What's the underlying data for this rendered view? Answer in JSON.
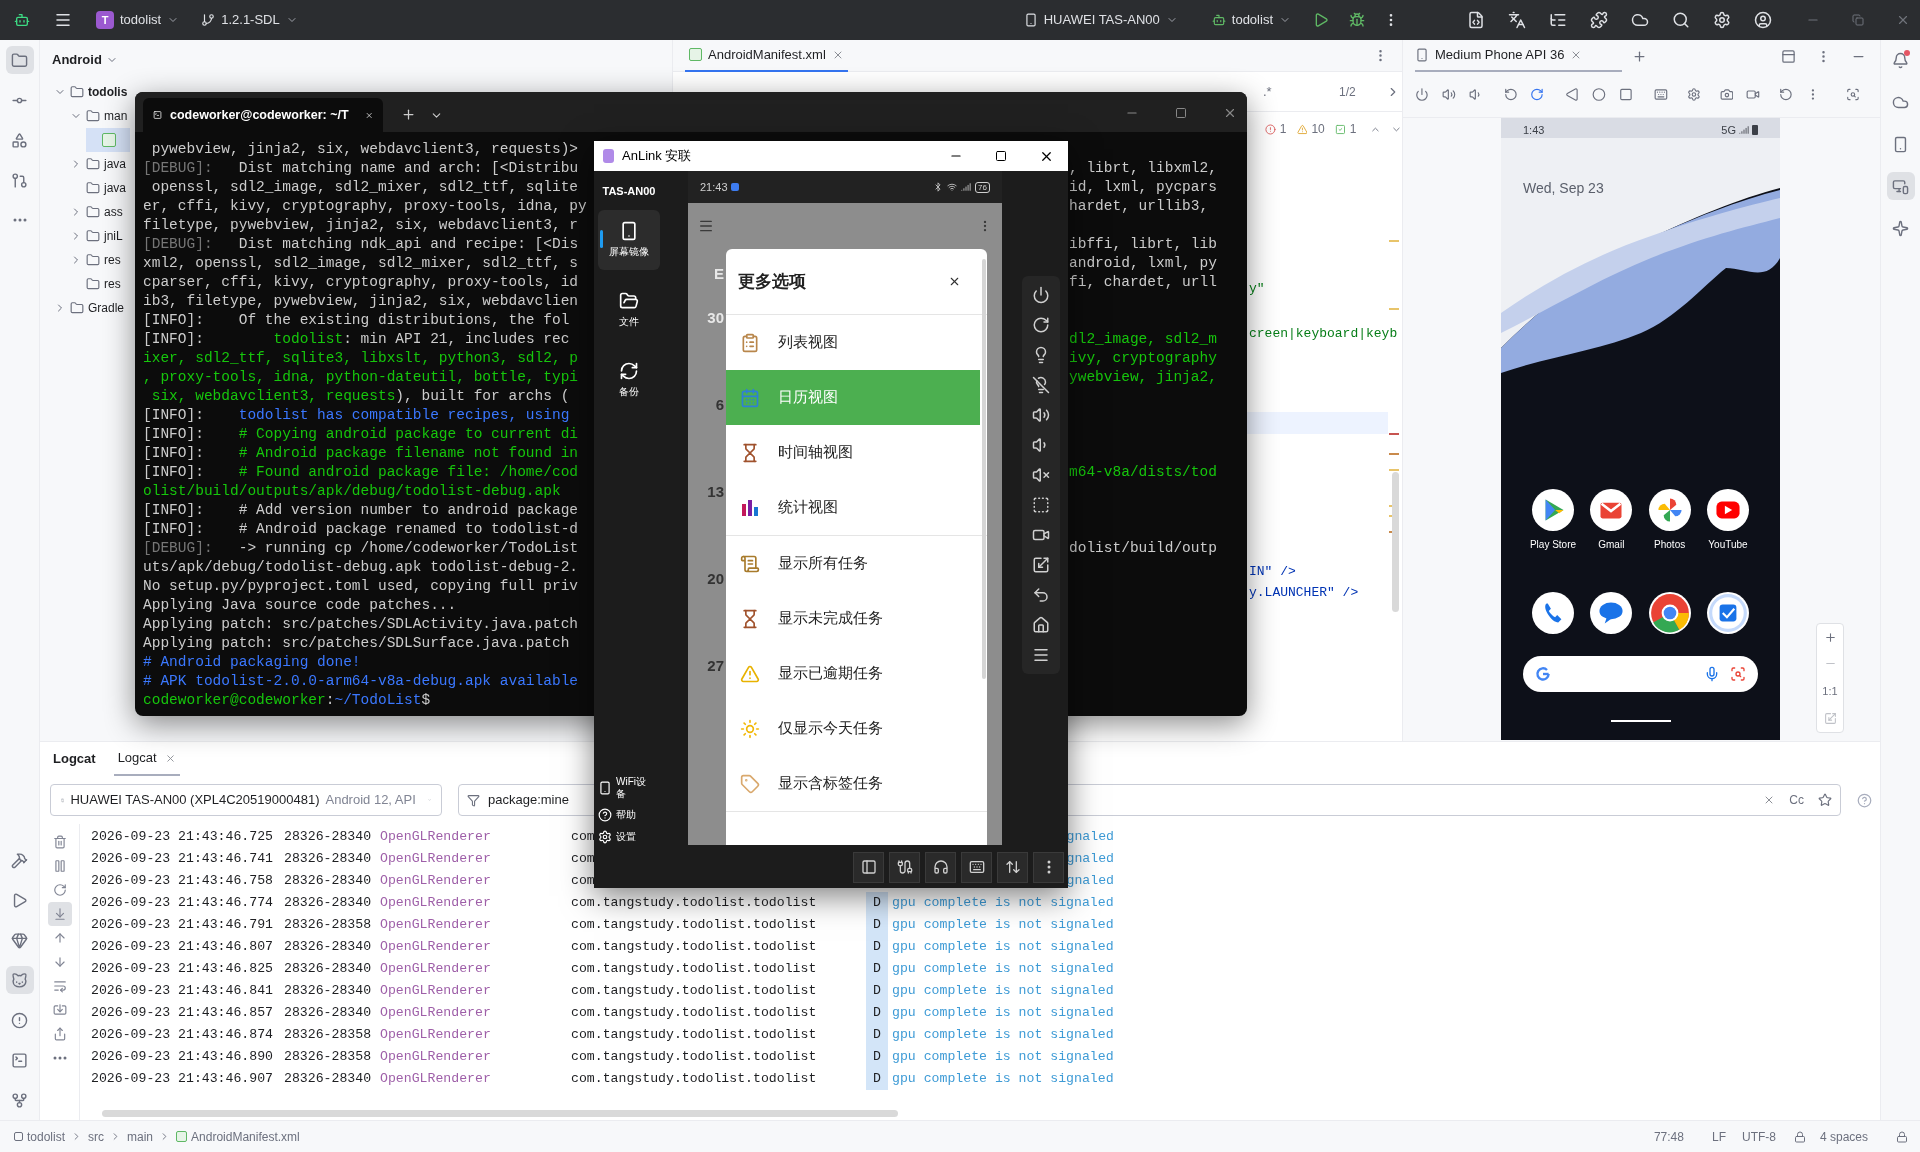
{
  "top_bar": {
    "project_initial": "T",
    "project": "todolist",
    "branch": "1.2.1-SDL",
    "device": "HUAWEI TAS-AN00",
    "run_config": "todolist"
  },
  "left_strip": {
    "top": [
      {
        "kind": "folder",
        "selected": true
      },
      {
        "kind": "commit",
        "selected": false
      },
      {
        "kind": "structure",
        "selected": false
      },
      {
        "kind": "pull-request",
        "selected": false
      },
      {
        "kind": "more",
        "selected": false
      }
    ],
    "bottom": [
      {
        "kind": "hammer",
        "selected": false
      },
      {
        "kind": "run",
        "selected": false
      },
      {
        "kind": "gem",
        "selected": false
      },
      {
        "kind": "cat",
        "selected": true
      },
      {
        "kind": "problems",
        "selected": false
      },
      {
        "kind": "terminal",
        "selected": false
      },
      {
        "kind": "git",
        "selected": false
      }
    ]
  },
  "right_strip": [
    {
      "kind": "bell",
      "selected": false
    },
    {
      "kind": "gradle",
      "selected": false
    },
    {
      "kind": "devices",
      "selected": false
    },
    {
      "kind": "running",
      "selected": true
    },
    {
      "kind": "sparkle",
      "selected": false
    }
  ],
  "project_panel": {
    "title": "Android",
    "tree": [
      {
        "label": "todolis",
        "expanded": true,
        "children": [
          {
            "label": "man",
            "expanded": true,
            "children": [
              {
                "selected": true
              }
            ]
          },
          {
            "label": "java",
            "expanded": false
          },
          {
            "label": "java"
          },
          {
            "label": "ass",
            "expanded": false
          },
          {
            "label": "jniL",
            "expanded": false
          },
          {
            "label": "res",
            "expanded": false
          },
          {
            "label": "res"
          }
        ]
      },
      {
        "label": "Gradle",
        "expanded": false
      }
    ]
  },
  "editor": {
    "tab": {
      "label": "AndroidManifest.xml",
      "selected": true
    },
    "find": {
      "regex": ".*",
      "matches": "1/2"
    },
    "problems": {
      "errors": "1",
      "warnings": "10",
      "weak": "1"
    },
    "code_lines": [
      "y\"",
      "creen|keyboard|keyb",
      "IN\" />",
      "y.LAUNCHER\" />"
    ]
  },
  "emulator": {
    "tab": {
      "label": "Medium Phone API 36",
      "selected": true
    },
    "phone": {
      "time": "1:43",
      "network": "5G",
      "date": "Wed, Sep 23",
      "apps": [
        {
          "label": "Play Store",
          "kind": "play"
        },
        {
          "label": "Gmail",
          "kind": "mail"
        },
        {
          "label": "Photos",
          "kind": "pinwheel"
        },
        {
          "label": "YouTube",
          "kind": "video"
        }
      ],
      "dock": [
        {
          "kind": "phone"
        },
        {
          "kind": "chat"
        },
        {
          "kind": "browser"
        },
        {
          "kind": "checkbox"
        }
      ]
    },
    "zoom_label": "1:1"
  },
  "logcat": {
    "title": "Logcat",
    "tabs": [
      {
        "label": "Logcat",
        "selected": true
      }
    ],
    "device": "HUAWEI TAS-AN00 (XPL4C20519000481)",
    "device_detail": "Android 12, API",
    "filter": "package:mine",
    "match_case": "Cc",
    "tools": [
      {
        "kind": "trash",
        "selected": false
      },
      {
        "kind": "pause",
        "selected": false
      },
      {
        "kind": "restart",
        "selected": false
      },
      {
        "kind": "scroll-end",
        "selected": true
      },
      {
        "kind": "up",
        "selected": false
      },
      {
        "kind": "down",
        "selected": false
      },
      {
        "kind": "wrap",
        "selected": false
      },
      {
        "kind": "import",
        "selected": false
      },
      {
        "kind": "export",
        "selected": false
      },
      {
        "kind": "more",
        "selected": false
      }
    ],
    "rows": [
      {
        "time": "2026-09-23 21:43:46.725",
        "pid": "28326-28340",
        "tag": "OpenGLRenderer",
        "package": "com",
        "message": "gnaled"
      },
      {
        "time": "2026-09-23 21:43:46.741",
        "pid": "28326-28340",
        "tag": "OpenGLRenderer",
        "package": "com",
        "message": "gnaled"
      },
      {
        "time": "2026-09-23 21:43:46.758",
        "pid": "28326-28340",
        "tag": "OpenGLRenderer",
        "package": "com",
        "message": "gnaled"
      },
      {
        "time": "2026-09-23 21:43:46.774",
        "pid": "28326-28340",
        "tag": "OpenGLRenderer",
        "package": "com.tangstudy.todolist.todolist",
        "level": "D",
        "message": "gpu complete is not signaled"
      },
      {
        "time": "2026-09-23 21:43:46.791",
        "pid": "28326-28358",
        "tag": "OpenGLRenderer",
        "package": "com.tangstudy.todolist.todolist",
        "level": "D",
        "message": "gpu complete is not signaled"
      },
      {
        "time": "2026-09-23 21:43:46.807",
        "pid": "28326-28340",
        "tag": "OpenGLRenderer",
        "package": "com.tangstudy.todolist.todolist",
        "level": "D",
        "message": "gpu complete is not signaled"
      },
      {
        "time": "2026-09-23 21:43:46.825",
        "pid": "28326-28340",
        "tag": "OpenGLRenderer",
        "package": "com.tangstudy.todolist.todolist",
        "level": "D",
        "message": "gpu complete is not signaled"
      },
      {
        "time": "2026-09-23 21:43:46.841",
        "pid": "28326-28340",
        "tag": "OpenGLRenderer",
        "package": "com.tangstudy.todolist.todolist",
        "level": "D",
        "message": "gpu complete is not signaled"
      },
      {
        "time": "2026-09-23 21:43:46.857",
        "pid": "28326-28340",
        "tag": "OpenGLRenderer",
        "package": "com.tangstudy.todolist.todolist",
        "level": "D",
        "message": "gpu complete is not signaled"
      },
      {
        "time": "2026-09-23 21:43:46.874",
        "pid": "28326-28358",
        "tag": "OpenGLRenderer",
        "package": "com.tangstudy.todolist.todolist",
        "level": "D",
        "message": "gpu complete is not signaled"
      },
      {
        "time": "2026-09-23 21:43:46.890",
        "pid": "28326-28358",
        "tag": "OpenGLRenderer",
        "package": "com.tangstudy.todolist.todolist",
        "level": "D",
        "message": "gpu complete is not signaled"
      },
      {
        "time": "2026-09-23 21:43:46.907",
        "pid": "28326-28340",
        "tag": "OpenGLRenderer",
        "package": "com.tangstudy.todolist.todolist",
        "level": "D",
        "message": "gpu complete is not signaled"
      }
    ]
  },
  "status_bar": {
    "breadcrumbs": [
      "todolist",
      "src",
      "main",
      "AndroidManifest.xml"
    ],
    "position": "77:48",
    "line_separator": "LF",
    "encoding": "UTF-8",
    "indent": "4 spaces"
  },
  "terminal": {
    "tab_title": "codeworker@codeworker: ~/T",
    "lines": [
      {
        "segments": [
          {
            "text": " pywebview, jinja2, six, webdavclient3, requests)>",
            "kind": "plain"
          }
        ]
      },
      {
        "segments": [
          {
            "text": "[DEBUG]:",
            "kind": "debug"
          },
          {
            "text": "   Dist matching name and arch: [<Distribu",
            "kind": "plain"
          }
        ],
        "right": {
          "text": ", librt, libxml2,",
          "kind": "plain"
        }
      },
      {
        "segments": [
          {
            "text": " openssl, sdl2_image, sdl2_mixer, sdl2_ttf, sqlite",
            "kind": "plain"
          }
        ],
        "right": {
          "text": "id, lxml, pycpars",
          "kind": "plain"
        }
      },
      {
        "segments": [
          {
            "text": "er, cffi, kivy, cryptography, proxy-tools, idna, py",
            "kind": "plain"
          }
        ],
        "right": {
          "text": "hardet, urllib3,",
          "kind": "plain"
        }
      },
      {
        "segments": [
          {
            "text": "filetype, pywebview, jinja2, six, webdavclient3, r",
            "kind": "plain"
          }
        ]
      },
      {
        "segments": [
          {
            "text": "[DEBUG]:",
            "kind": "debug"
          },
          {
            "text": "   Dist matching ndk_api and recipe: [<Dis",
            "kind": "plain"
          }
        ],
        "right": {
          "text": "ibffi, librt, lib",
          "kind": "plain"
        }
      },
      {
        "segments": [
          {
            "text": "xml2, openssl, sdl2_image, sdl2_mixer, sdl2_ttf, s",
            "kind": "plain"
          }
        ],
        "right": {
          "text": "android, lxml, py",
          "kind": "plain"
        }
      },
      {
        "segments": [
          {
            "text": "cparser, cffi, kivy, cryptography, proxy-tools, id",
            "kind": "plain"
          }
        ],
        "right": {
          "text": "fi, chardet, urll",
          "kind": "plain"
        }
      },
      {
        "segments": [
          {
            "text": "ib3, filetype, pywebview, jinja2, six, webdavclien",
            "kind": "plain"
          }
        ]
      },
      {
        "segments": [
          {
            "text": "[INFO]:    Of the existing distributions, the fol",
            "kind": "plain"
          }
        ]
      },
      {
        "segments": [
          {
            "text": "[INFO]:        ",
            "kind": "plain"
          },
          {
            "text": "todolist",
            "kind": "green"
          },
          {
            "text": ": min API 21, includes rec",
            "kind": "plain"
          }
        ],
        "right": {
          "text": "dl2_image, sdl2_m",
          "kind": "green"
        }
      },
      {
        "segments": [
          {
            "text": "ixer, sdl2_ttf, sqlite3, libxslt, python3, sdl2, p",
            "kind": "green"
          }
        ],
        "right": {
          "text": "ivy, cryptography",
          "kind": "green"
        }
      },
      {
        "segments": [
          {
            "text": ", proxy-tools, idna, python-dateutil, bottle, typi",
            "kind": "green"
          }
        ],
        "right": {
          "text": "ywebview, jinja2,",
          "kind": "green"
        }
      },
      {
        "segments": [
          {
            "text": " six, webdavclient3, requests",
            "kind": "green"
          },
          {
            "text": "), built for archs (",
            "kind": "plain"
          }
        ]
      },
      {
        "segments": [
          {
            "text": "[INFO]:    ",
            "kind": "plain"
          },
          {
            "text": "todolist has compatible recipes, using",
            "kind": "blue"
          }
        ]
      },
      {
        "segments": [
          {
            "text": "[INFO]:    ",
            "kind": "plain"
          },
          {
            "text": "# Copying android package to current di",
            "kind": "green"
          }
        ]
      },
      {
        "segments": [
          {
            "text": "[INFO]:    ",
            "kind": "plain"
          },
          {
            "text": "# Android package filename not found in",
            "kind": "green"
          }
        ]
      },
      {
        "segments": [
          {
            "text": "[INFO]:    ",
            "kind": "plain"
          },
          {
            "text": "# Found android package file: /home/cod",
            "kind": "green"
          }
        ],
        "right": {
          "text": "m64-v8a/dists/tod",
          "kind": "green"
        }
      },
      {
        "segments": [
          {
            "text": "olist/build/outputs/apk/debug/todolist-debug.apk",
            "kind": "green"
          }
        ]
      },
      {
        "segments": [
          {
            "text": "[INFO]:    # Add version number to android package",
            "kind": "plain"
          }
        ]
      },
      {
        "segments": [
          {
            "text": "[INFO]:    # Android package renamed to todolist-d",
            "kind": "plain"
          }
        ]
      },
      {
        "segments": [
          {
            "text": "[DEBUG]:",
            "kind": "debug"
          },
          {
            "text": "   -> running cp /home/codeworker/TodoList",
            "kind": "plain"
          }
        ],
        "right": {
          "text": "dolist/build/outp",
          "kind": "plain"
        }
      },
      {
        "segments": [
          {
            "text": "uts/apk/debug/todolist-debug.apk todolist-debug-2.",
            "kind": "plain"
          }
        ]
      },
      {
        "segments": [
          {
            "text": "No setup.py/pyproject.toml used, copying full priv",
            "kind": "plain"
          }
        ]
      },
      {
        "segments": [
          {
            "text": "Applying Java source code patches...",
            "kind": "plain"
          }
        ]
      },
      {
        "segments": [
          {
            "text": "Applying patch: src/patches/SDLActivity.java.patch",
            "kind": "plain"
          }
        ]
      },
      {
        "segments": [
          {
            "text": "Applying patch: src/patches/SDLSurface.java.patch",
            "kind": "plain"
          }
        ]
      },
      {
        "segments": [
          {
            "text": "# Android packaging done!",
            "kind": "blue"
          }
        ]
      },
      {
        "segments": [
          {
            "text": "# APK todolist-2.0.0-arm64-v8a-debug.apk available",
            "kind": "blue"
          }
        ]
      },
      {
        "segments": [
          {
            "text": "codeworker@codeworker",
            "kind": "green"
          },
          {
            "text": ":",
            "kind": "plain"
          },
          {
            "text": "~/TodoList",
            "kind": "blue"
          },
          {
            "text": "$",
            "kind": "plain"
          }
        ]
      }
    ]
  },
  "anlink": {
    "title": "AnLink 安联",
    "device": "TAS-AN00",
    "nav": [
      {
        "label": "屏幕镜像",
        "kind": "mirror",
        "selected": true
      },
      {
        "label": "文件",
        "kind": "files",
        "selected": false
      },
      {
        "label": "备份",
        "kind": "backup",
        "selected": false
      }
    ],
    "bottom_nav": [
      {
        "label": "WiFi设备",
        "kind": "wifi"
      },
      {
        "label": "帮助",
        "kind": "help"
      },
      {
        "label": "设置",
        "kind": "settings"
      }
    ],
    "phone": {
      "time": "21:43",
      "battery": "76",
      "calendar_cells": [
        "E",
        "30",
        "6",
        "13",
        "20",
        "27"
      ],
      "dialog": {
        "title": "更多选项",
        "groups": [
          [
            {
              "label": "列表视图",
              "kind": "clipboard",
              "selected": false
            },
            {
              "label": "日历视图",
              "kind": "calendar",
              "selected": true
            },
            {
              "label": "时间轴视图",
              "kind": "hourglass",
              "selected": false
            },
            {
              "label": "统计视图",
              "kind": "chart",
              "selected": false
            }
          ],
          [
            {
              "label": "显示所有任务",
              "kind": "scroll",
              "selected": false
            },
            {
              "label": "显示未完成任务",
              "kind": "hourglass",
              "selected": false
            },
            {
              "label": "显示已逾期任务",
              "kind": "warning",
              "selected": false
            },
            {
              "label": "仅显示今天任务",
              "kind": "sun",
              "selected": false
            },
            {
              "label": "显示含标签任务",
              "kind": "tag",
              "selected": false
            }
          ]
        ]
      }
    }
  }
}
